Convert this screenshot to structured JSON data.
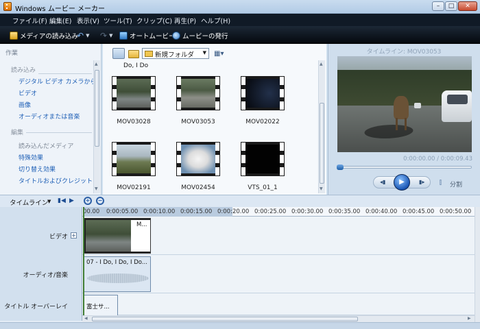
{
  "window": {
    "title": "Windows ムービー メーカー"
  },
  "menu": [
    "ファイル(F)",
    "編集(E)",
    "表示(V)",
    "ツール(T)",
    "クリップ(C)",
    "再生(P)",
    "ヘルプ(H)"
  ],
  "toolbar": {
    "import_label": "メディアの読み込み",
    "automovie_label": "オートムービー",
    "publish_label": "ムービーの発行"
  },
  "tasks": {
    "title": "作業",
    "import_section": "読み込み",
    "import_links": [
      "デジタル ビデオ カメラから",
      "ビデオ",
      "画像",
      "オーディオまたは音楽"
    ],
    "edit_section": "編集",
    "edit_links": [
      "読み込んだメディア",
      "特殊効果",
      "切り替え効果",
      "タイトルおよびクレジット"
    ]
  },
  "collection": {
    "folder": "新規フォルダ",
    "heading": "Do, I Do",
    "clips": [
      {
        "name": "MOV03028",
        "thumb": "road"
      },
      {
        "name": "MOV03053",
        "thumb": "road2"
      },
      {
        "name": "MOV02022",
        "thumb": "dark"
      },
      {
        "name": "MOV02191",
        "thumb": "land"
      },
      {
        "name": "MOV02454",
        "thumb": "dog"
      },
      {
        "name": "VTS_01_1",
        "thumb": "black"
      }
    ]
  },
  "preview": {
    "title": "タイムライン: MOV03053",
    "time": "0:00:00.00 / 0:00:09.43",
    "split_label": "分割",
    "progress": 0
  },
  "timeline": {
    "label": "タイムライン",
    "ticks": [
      "00.00",
      "0:00:05.00",
      "0:00:10.00",
      "0:00:15.00",
      "0:00:20.00",
      "0:00:25.00",
      "0:00:30.00",
      "0:00:35.00",
      "0:00:40.00",
      "0:00:45.00",
      "0:00:50.00"
    ],
    "tracks": {
      "video": "ビデオ",
      "audio": "オーディオ/音楽",
      "title": "タイトル オーバーレイ"
    },
    "video_clip": "M...",
    "audio_clip": "07 - I Do, I Do, I Do...",
    "title_clip": "富士サ..."
  },
  "icons": {
    "app": "movie-maker-icon",
    "import": "import-icon",
    "automovie": "automovie-icon",
    "publish": "publish-icon"
  },
  "colors": {
    "link": "#1e5fb6",
    "menubar": "#101a26",
    "accent": "#1a56b4"
  }
}
